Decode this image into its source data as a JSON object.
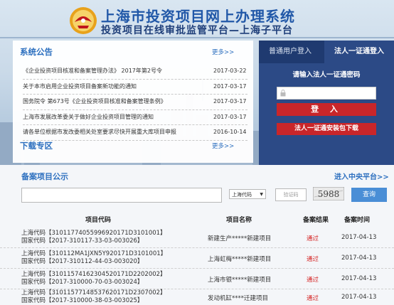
{
  "header": {
    "title": "上海市投资项目网上办理系统",
    "subtitle": "投资项目在线审批监管平台—上海子平台"
  },
  "notice": {
    "title": "系统公告",
    "more": "更多>>",
    "items": [
      {
        "title": "《企业投资项目核准和备案管理办法》   2017年第2号令",
        "date": "2017-03-22"
      },
      {
        "title": "关于本市启用企业投资项目备案新功能的通知",
        "date": "2017-03-17"
      },
      {
        "title": "国务院令 第673号《企业投资项目核准和备案管理条例》",
        "date": "2017-03-17"
      },
      {
        "title": "上海市发展改革委关于做好企业投资项目管理的通知",
        "date": "2017-03-17"
      },
      {
        "title": "请各单位根据市发改委相关处室要求尽快开展重大库项目申报",
        "date": "2016-10-14"
      }
    ]
  },
  "download": {
    "title": "下载专区",
    "more": "更多>>"
  },
  "login": {
    "tab_normal": "普通用户登入",
    "tab_legal": "法人一证通登入",
    "prompt": "请输入法人一证通密码",
    "password_placeholder": "",
    "login_button": "登  入",
    "download_button": "法人一证通安装包下载"
  },
  "filing": {
    "title": "备案项目公示",
    "central_link": "进入中央平台>>",
    "search_value": "",
    "code_select": "上海代码",
    "captcha_placeholder": "验证码",
    "captcha_text": "5988",
    "query_button": "查询",
    "columns": [
      "项目代码",
      "项目名称",
      "备案结果",
      "备案时间"
    ],
    "rows": [
      {
        "code1": "上海代码【31011774055996920171D3101001】",
        "code2": "国家代码【2017-310117-33-03-003026】",
        "name": "新建生产*****新建项目",
        "result": "通过",
        "date": "2017-04-13"
      },
      {
        "code1": "上海代码【310112MA1JXN5Y920171D3101001】",
        "code2": "国家代码【2017-310112-44-03-003020】",
        "name": "上海虹梅*****新建项目",
        "result": "通过",
        "date": "2017-04-13"
      },
      {
        "code1": "上海代码【31011574162304520171D2202002】",
        "code2": "国家代码【2017-310000-70-03-003024】",
        "name": "上海市银*****新建项目",
        "result": "通过",
        "date": "2017-04-13"
      },
      {
        "code1": "上海代码【31011577148537620171D2307002】",
        "code2": "国家代码【2017-310000-38-03-003025】",
        "name": "发动机缸****迁建项目",
        "result": "通过",
        "date": "2017-04-13"
      }
    ]
  },
  "colors": {
    "brand_blue": "#2158a8",
    "login_panel": "#2c4a86",
    "button_red": "#c9262a",
    "query_blue": "#4a8ed6",
    "pass_red": "#d52020"
  },
  "icons": [
    "shanghai-emblem-logo",
    "lock-icon",
    "chevron-down-icon"
  ]
}
